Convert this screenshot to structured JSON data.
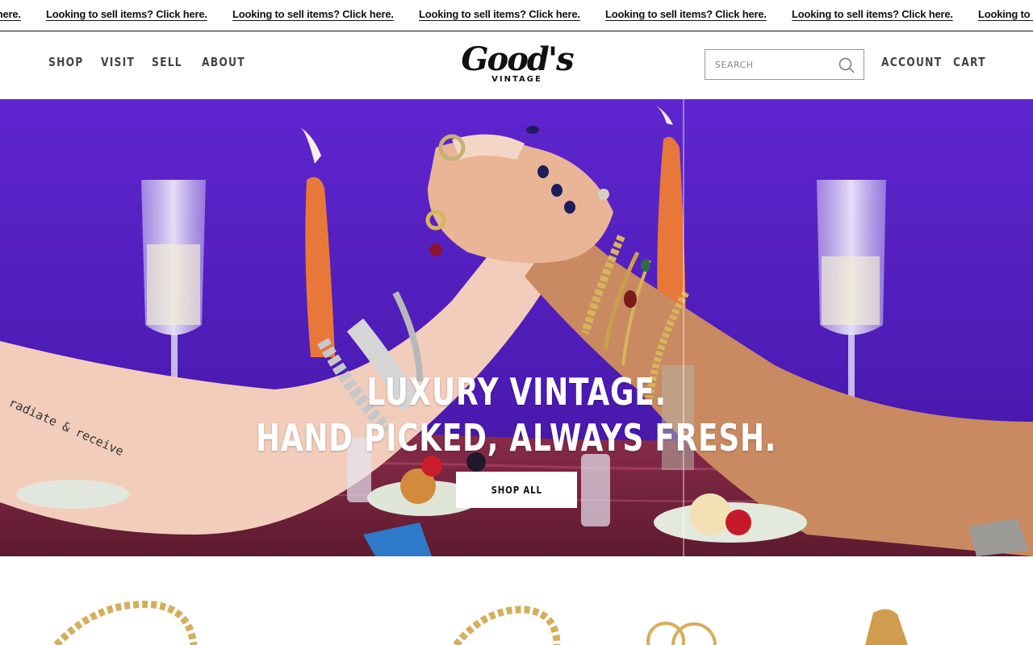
{
  "announcement": {
    "text": "Looking to sell items? Click here.",
    "items": [
      "Looking to sell items? Click here.",
      "Looking to sell items? Click here.",
      "Looking to sell items? Click here.",
      "Looking to sell items? Click here.",
      "Looking to sell items? Click here.",
      "Looking to sell items? Click here.",
      "Looking to sell items? Click here."
    ]
  },
  "header": {
    "nav": [
      "SHOP",
      "VISIT",
      "SELL",
      "ABOUT"
    ],
    "logo": {
      "word": "Good's",
      "sub": "VINTAGE"
    },
    "search": {
      "placeholder": "SEARCH",
      "value": ""
    },
    "account_label": "ACCOUNT",
    "cart_label": "CART"
  },
  "hero": {
    "title_line1": "LUXURY VINTAGE.",
    "title_line2": "HAND PICKED, ALWAYS FRESH.",
    "cta_label": "SHOP ALL",
    "tattoo_text": "radiate & receive"
  },
  "colors": {
    "hero_background": "#5a22c6",
    "announcement_text": "#111111",
    "nav_text": "#444444",
    "button_background": "#ffffff"
  },
  "icons": {
    "search": "search-icon"
  }
}
